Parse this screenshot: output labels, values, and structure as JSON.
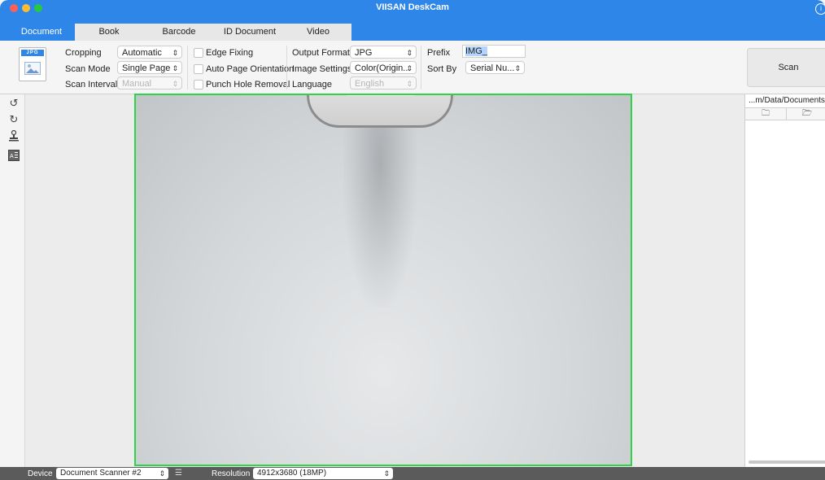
{
  "window": {
    "title": "VIISAN DeskCam"
  },
  "tabs": [
    "Document",
    "Book",
    "Barcode",
    "ID Document",
    "Video"
  ],
  "ribbon": {
    "icon_label": "JPG",
    "cropping": {
      "label": "Cropping",
      "value": "Automatic"
    },
    "scan_mode": {
      "label": "Scan Mode",
      "value": "Single Page"
    },
    "scan_interval": {
      "label": "Scan Interval",
      "value": "Manual"
    },
    "edge_fixing": "Edge Fixing",
    "auto_page_orientation": "Auto Page Orientation",
    "punch_hole_removal": "Punch Hole Removal",
    "output_format": {
      "label": "Output Format",
      "value": "JPG"
    },
    "image_settings": {
      "label": "Image Settings",
      "value": "Color(Origin..."
    },
    "language": {
      "label": "Language",
      "value": "English"
    },
    "prefix": {
      "label": "Prefix",
      "value": "IMG_"
    },
    "sort_by": {
      "label": "Sort By",
      "value": "Serial Nu..."
    },
    "scan_button": "Scan"
  },
  "right_panel": {
    "path": "...m/Data/Documents"
  },
  "status": {
    "device_label": "Device",
    "device_value": "Document Scanner #2",
    "resolution_label": "Resolution",
    "resolution_value": "4912x3680 (18MP)"
  },
  "colors": {
    "accent": "#2d86e8",
    "preview_border": "#2fd34a"
  },
  "icons": [
    "rotate-ccw-icon",
    "rotate-cw-icon",
    "stamp-icon",
    "ocr-icon",
    "folder-icon",
    "folder-open-icon",
    "settings-sliders-icon"
  ]
}
